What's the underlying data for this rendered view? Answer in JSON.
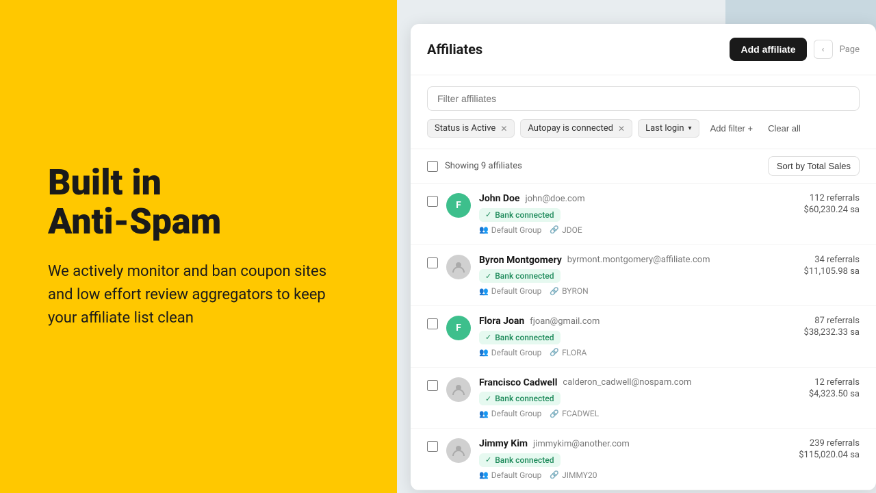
{
  "left": {
    "headline_line1": "Built in",
    "headline_line2": "Anti-Spam",
    "description": "We actively monitor and ban coupon sites and low effort review aggregators to keep your affiliate list clean"
  },
  "app": {
    "title": "Affiliates",
    "add_button": "Add affiliate",
    "page_label": "Page",
    "search_placeholder": "Filter affiliates",
    "filters": [
      {
        "label": "Status is Active",
        "removable": true
      },
      {
        "label": "Autopay is connected",
        "removable": true
      },
      {
        "label": "Last login",
        "removable": false,
        "dropdown": true
      }
    ],
    "add_filter_label": "Add filter +",
    "clear_all_label": "Clear all",
    "showing_label": "Showing 9 affiliates",
    "sort_label": "Sort by Total Sales",
    "affiliates": [
      {
        "name": "John Doe",
        "email": "john@doe.com",
        "avatar_initial": "F",
        "avatar_color": "green",
        "bank_connected": "Bank connected",
        "group": "Default Group",
        "code": "JDOE",
        "referrals": "112 referrals",
        "sales": "$60,230.24 sa"
      },
      {
        "name": "Byron Montgomery",
        "email": "byrmont.montgomery@affiliate.com",
        "avatar_initial": "",
        "avatar_color": "gray",
        "bank_connected": "Bank connected",
        "group": "Default Group",
        "code": "BYRON",
        "referrals": "34 referrals",
        "sales": "$11,105.98 sa"
      },
      {
        "name": "Flora Joan",
        "email": "fjoan@gmail.com",
        "avatar_initial": "F",
        "avatar_color": "green",
        "bank_connected": "Bank connected",
        "group": "Default Group",
        "code": "FLORA",
        "referrals": "87 referrals",
        "sales": "$38,232.33 sa"
      },
      {
        "name": "Francisco Cadwell",
        "email": "calderon_cadwell@nospam.com",
        "avatar_initial": "",
        "avatar_color": "gray",
        "bank_connected": "Bank connected",
        "group": "Default Group",
        "code": "FCADWEL",
        "referrals": "12 referrals",
        "sales": "$4,323.50 sa"
      },
      {
        "name": "Jimmy Kim",
        "email": "jimmykim@another.com",
        "avatar_initial": "",
        "avatar_color": "gray",
        "bank_connected": "Bank connected",
        "group": "Default Group",
        "code": "JIMMY20",
        "referrals": "239 referrals",
        "sales": "$115,020.04 sa"
      }
    ]
  }
}
